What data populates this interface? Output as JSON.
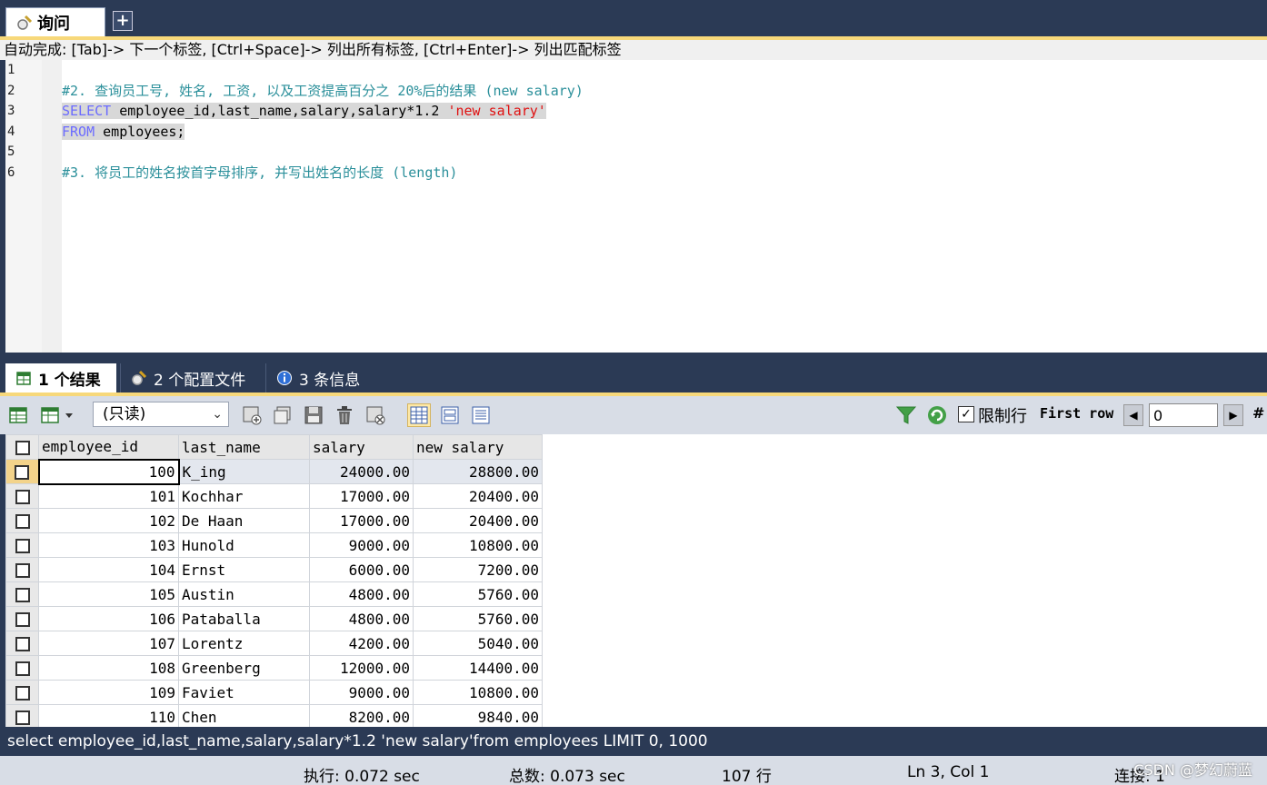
{
  "tabs": {
    "query_label": "询问",
    "add_label": "+"
  },
  "hint": "自动完成: [Tab]-> 下一个标签, [Ctrl+Space]-> 列出所有标签, [Ctrl+Enter]-> 列出匹配标签",
  "editor": {
    "line_numbers": [
      "1",
      "2",
      "3",
      "4",
      "5",
      "6"
    ],
    "line2": "#2. 查询员工号, 姓名, 工资, 以及工资提高百分之 20%后的结果 (new salary)",
    "line3_kw": "SELECT",
    "line3_rest": " employee_id,last_name,salary,salary*1.2 ",
    "line3_str": "'new salary'",
    "line4_kw": "FROM",
    "line4_rest": " employees;",
    "line6": "#3. 将员工的姓名按首字母排序, 并写出姓名的长度 (length)"
  },
  "result_tabs": [
    {
      "label": "1 个结果",
      "icon": "result-grid-icon"
    },
    {
      "label": "2 个配置文件",
      "icon": "profile-icon"
    },
    {
      "label": "3 条信息",
      "icon": "info-icon"
    }
  ],
  "toolbar": {
    "readonly_option": "(只读)",
    "limit_label": "限制行",
    "limit_checked": true,
    "first_row_label": "First row",
    "first_row_value": "0",
    "hash_label": "#"
  },
  "grid": {
    "columns": [
      "employee_id",
      "last_name",
      "salary",
      "new salary"
    ],
    "rows": [
      [
        "100",
        "K_ing",
        "24000.00",
        "28800.00"
      ],
      [
        "101",
        "Kochhar",
        "17000.00",
        "20400.00"
      ],
      [
        "102",
        "De Haan",
        "17000.00",
        "20400.00"
      ],
      [
        "103",
        "Hunold",
        "9000.00",
        "10800.00"
      ],
      [
        "104",
        "Ernst",
        "6000.00",
        "7200.00"
      ],
      [
        "105",
        "Austin",
        "4800.00",
        "5760.00"
      ],
      [
        "106",
        "Pataballa",
        "4800.00",
        "5760.00"
      ],
      [
        "107",
        "Lorentz",
        "4200.00",
        "5040.00"
      ],
      [
        "108",
        "Greenberg",
        "12000.00",
        "14400.00"
      ],
      [
        "109",
        "Faviet",
        "9000.00",
        "10800.00"
      ],
      [
        "110",
        "Chen",
        "8200.00",
        "9840.00"
      ]
    ]
  },
  "sql_bar": "select employee_id,last_name,salary,salary*1.2 'new salary'from employees LIMIT 0, 1000",
  "status": {
    "exec": "执行: 0.072 sec",
    "total": "总数: 0.073 sec",
    "rows": "107 行",
    "position": "Ln 3, Col 1",
    "connection": "连接: 1"
  },
  "watermark": "CSDN @梦幻蔚蓝",
  "colors": {
    "chrome": "#2b3a55",
    "accent_stripe": "#f7d87a",
    "comment": "#2a8f9a",
    "keyword": "#6b6bff",
    "string": "#e01010"
  }
}
